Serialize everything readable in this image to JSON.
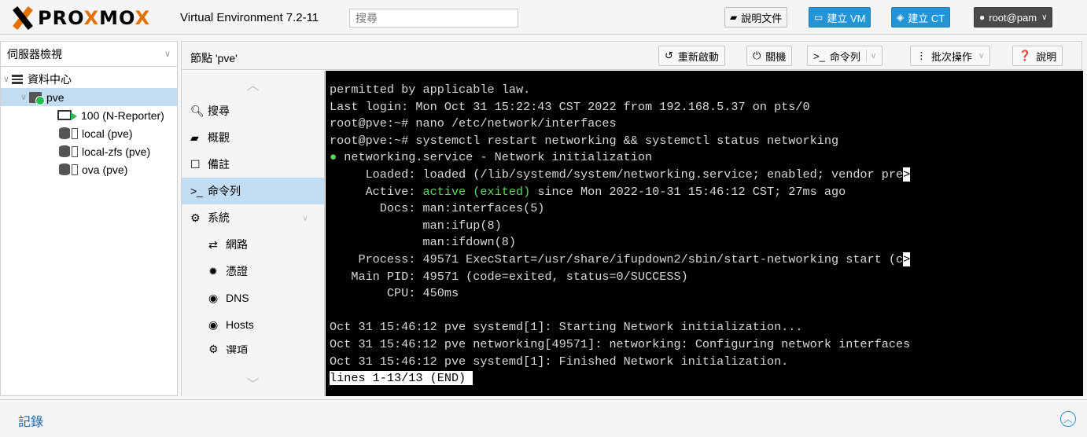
{
  "header": {
    "brand_prefix": "PRO",
    "brand_o": "X",
    "brand_mid": "MO",
    "brand_end": "X",
    "title": "Virtual Environment 7.2-11",
    "search_placeholder": "搜尋",
    "docs_label": "說明文件",
    "create_vm_label": "建立 VM",
    "create_ct_label": "建立 CT",
    "user_label": "root@pam"
  },
  "tree": {
    "view_label": "伺服器檢視",
    "datacenter": "資料中心",
    "node": "pve",
    "vm": "100 (N-Reporter)",
    "storages": [
      "local (pve)",
      "local-zfs (pve)",
      "ova (pve)"
    ]
  },
  "content": {
    "node_title": "節點 'pve'",
    "toolbar": {
      "reboot": "重新啟動",
      "shutdown": "關機",
      "shell": "命令列",
      "bulk": "批次操作",
      "help": "說明"
    }
  },
  "nav": {
    "search": "搜尋",
    "summary": "概觀",
    "notes": "備註",
    "shell": "命令列",
    "system": "系統",
    "network": "網路",
    "certificates": "憑證",
    "dns": "DNS",
    "hosts": "Hosts",
    "options": "選項"
  },
  "terminal": {
    "lines": [
      "permitted by applicable law.",
      "Last login: Mon Oct 31 15:22:43 CST 2022 from 192.168.5.37 on pts/0",
      "root@pve:~# nano /etc/network/interfaces",
      "root@pve:~# systemctl restart networking && systemctl status networking"
    ],
    "service_line": " networking.service - Network initialization",
    "loaded_line": "     Loaded: loaded (/lib/systemd/system/networking.service; enabled; vendor pre",
    "active_prefix": "     Active: ",
    "active_state": "active (exited)",
    "active_suffix": " since Mon 2022-10-31 15:46:12 CST; 27ms ago",
    "rest_lines": [
      "       Docs: man:interfaces(5)",
      "             man:ifup(8)",
      "             man:ifdown(8)",
      "    Process: 49571 ExecStart=/usr/share/ifupdown2/sbin/start-networking start (c",
      "   Main PID: 49571 (code=exited, status=0/SUCCESS)",
      "        CPU: 450ms",
      "",
      "Oct 31 15:46:12 pve systemd[1]: Starting Network initialization...",
      "Oct 31 15:46:12 pve networking[49571]: networking: Configuring network interfaces",
      "Oct 31 15:46:12 pve systemd[1]: Finished Network initialization."
    ],
    "pager": "lines 1-13/13 (END)"
  },
  "log": {
    "title": "記錄"
  }
}
